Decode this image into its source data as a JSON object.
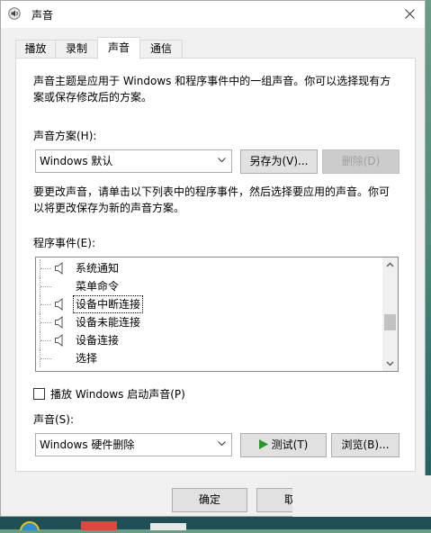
{
  "window": {
    "title": "声音"
  },
  "tabs": [
    {
      "label": "播放"
    },
    {
      "label": "录制"
    },
    {
      "label": "声音"
    },
    {
      "label": "通信"
    }
  ],
  "panel": {
    "description_line1": "声音主题是应用于 Windows 和程序事件中的一组声音。你可以选择现有方",
    "description_line2": "案或保存修改后的方案。",
    "scheme_label": "声音方案(H):",
    "scheme_value": "Windows 默认",
    "save_as_label": "另存为(V)...",
    "delete_label": "删除(D)",
    "instructions_line1": "要更改声音，请单击以下列表中的程序事件，然后选择要应用的声音。你可",
    "instructions_line2": "以将更改保存为新的声音方案。",
    "events_label": "程序事件(E):",
    "events": [
      {
        "label": "系统通知",
        "icon": "speaker-icon"
      },
      {
        "label": "菜单命令",
        "icon": ""
      },
      {
        "label": "设备中断连接",
        "icon": "speaker-icon",
        "selected": true
      },
      {
        "label": "设备未能连接",
        "icon": "speaker-icon"
      },
      {
        "label": "设备连接",
        "icon": "speaker-icon"
      },
      {
        "label": "选择",
        "icon": ""
      }
    ],
    "events_scroll_fraction": 0.62,
    "startup_sound_label": "播放 Windows 启动声音(P)",
    "startup_sound_checked": false,
    "sounds_label": "声音(S):",
    "sound_value": "Windows 硬件删除",
    "test_label": "测试(T)",
    "browse_label": "浏览(B)..."
  },
  "footer": {
    "ok_label": "确定",
    "cancel_label": "取"
  },
  "colors": {
    "accent": "#0078d7",
    "play_green": "#1e9e1e",
    "disabled_text": "#a0a0a0"
  }
}
